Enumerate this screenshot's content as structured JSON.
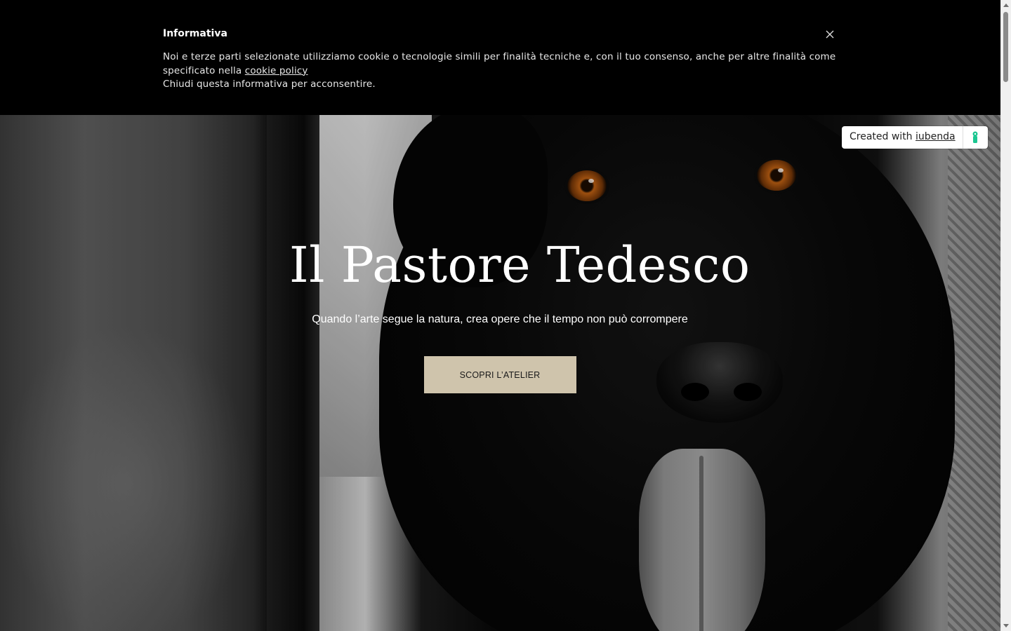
{
  "cookie_banner": {
    "title": "Informativa",
    "text_before_link": "Noi e terze parti selezionate utilizziamo cookie o tecnologie simili per finalità tecniche e, con il tuo consenso, anche per altre finalità come specificato nella ",
    "link_label": "cookie policy",
    "text_after_link": "Chiudi questa informativa per acconsentire.",
    "close_icon": "close-icon"
  },
  "iubenda_badge": {
    "prefix": "Created with ",
    "link_label": "iubenda",
    "icon": "iubenda-logo-icon",
    "icon_color": "#1cc691"
  },
  "hero": {
    "title": "Il Pastore Tedesco",
    "subtitle": "Quando l’arte segue la natura, crea opere che il tempo non può corrompere",
    "cta_label": "SCOPRI L’ATELIER",
    "cta_color": "#cfc4ac"
  },
  "scrollbar": {
    "up_icon": "scroll-up-arrow-icon",
    "down_icon": "scroll-down-arrow-icon"
  }
}
